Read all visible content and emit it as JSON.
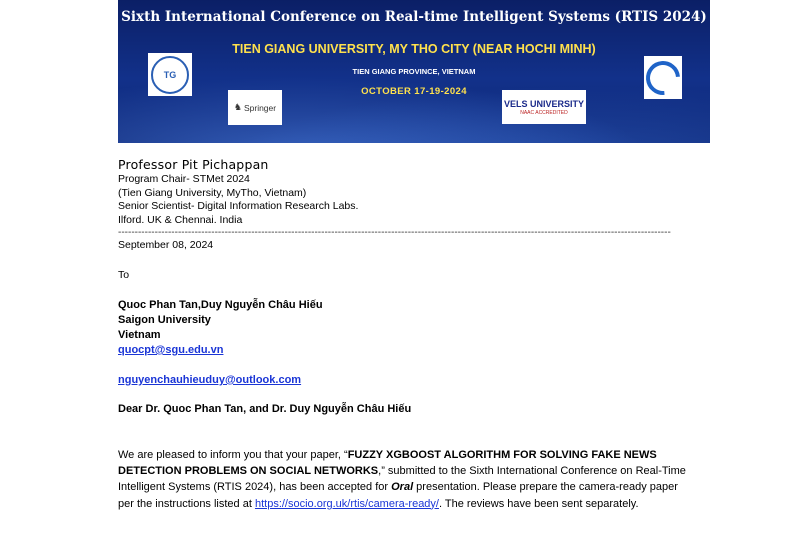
{
  "banner": {
    "title": "Sixth International Conference on Real-time Intelligent Systems (RTIS 2024)",
    "venue": "TIEN GIANG UNIVERSITY, MY THO CITY (NEAR HOCHI MINH)",
    "province": "TIEN GIANG PROVINCE, VIETNAM",
    "dates": "OCTOBER  17-19-2024",
    "logo_tgu": "TG",
    "logo_springer": "Springer",
    "logo_vels": "VELS UNIVERSITY",
    "logo_vels_sub": "NAAC ACCREDITED"
  },
  "sender": {
    "name": "Professor Pit Pichappan",
    "line1": "Program Chair- STMet 2024",
    "line2": "(Tien Giang University, MyTho, Vietnam)",
    "line3": "Senior Scientist- Digital Information Research Labs.",
    "line4": "Ilford. UK & Chennai. India"
  },
  "separator": "----------------------------------------------------------------------------------------------------------------------------------------------------------------------",
  "date": "September 08, 2024",
  "to_label": "To",
  "recipient": {
    "names": "Quoc Phan Tan,Duy Nguyễn Châu Hiếu",
    "university": "Saigon University",
    "country": "Vietnam",
    "email1": "quocpt@sgu.edu.vn ",
    "email2": "nguyenchauhieuduy@outlook.com "
  },
  "salutation": "Dear Dr. Quoc Phan Tan, and Dr. Duy Nguyễn Châu Hiếu",
  "body": {
    "p1_intro": "We are pleased to inform you that your paper, “",
    "paper_title": "FUZZY XGBOOST ALGORITHM FOR SOLVING FAKE NEWS DETECTION PROBLEMS ON SOCIAL NETWORKS",
    "p1_after_title": ",”       submitted to the Sixth International Conference on Real-Time Intelligent Systems (RTIS 2024), has been accepted for ",
    "presentation_type": "Oral",
    "p1_after_type": " presentation. Please prepare the camera-ready paper per the instructions listed at      ",
    "link": "https://socio.org.uk/rtis/camera-ready/",
    "p1_end": ". The reviews have been sent separately."
  }
}
